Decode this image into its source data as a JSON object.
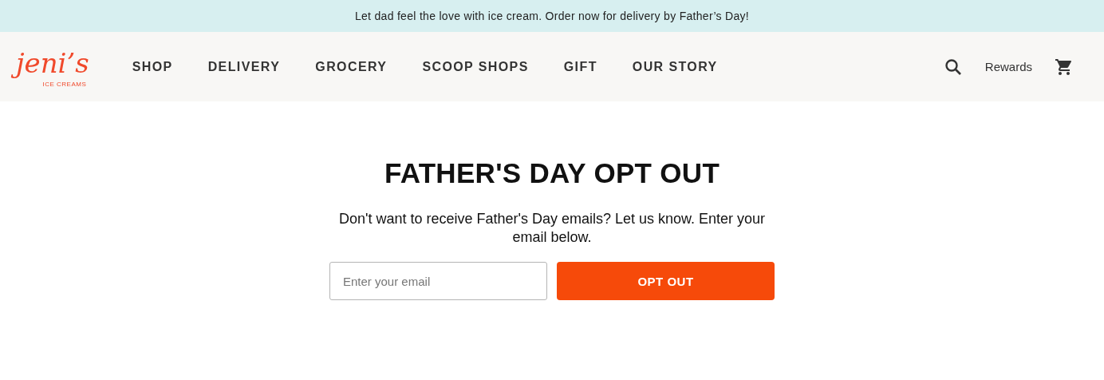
{
  "announcement": "Let dad feel the love with ice cream. Order now for delivery by Father’s Day!",
  "logo": {
    "wordmark": "jeni’s",
    "tagline": "ICE CREAMS"
  },
  "nav": [
    {
      "label": "SHOP"
    },
    {
      "label": "DELIVERY"
    },
    {
      "label": "GROCERY"
    },
    {
      "label": "SCOOP SHOPS"
    },
    {
      "label": "GIFT"
    },
    {
      "label": "OUR STORY"
    }
  ],
  "header_actions": {
    "rewards": "Rewards"
  },
  "main": {
    "title": "FATHER'S DAY OPT OUT",
    "description": "Don't want to receive Father's Day emails? Let us know. Enter your email below.",
    "email_placeholder": "Enter your email",
    "submit": "OPT OUT"
  }
}
